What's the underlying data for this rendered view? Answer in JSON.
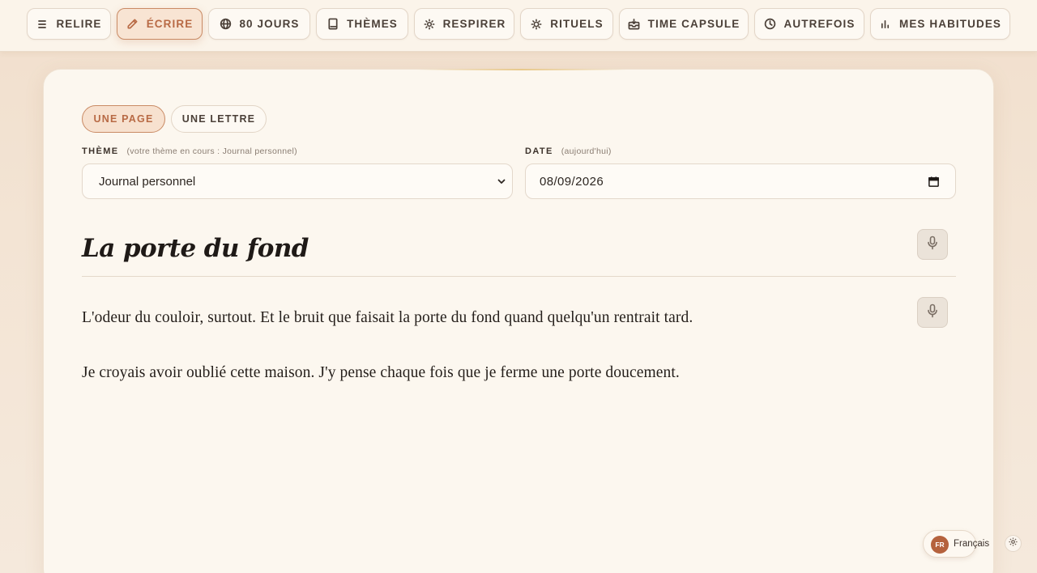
{
  "nav": {
    "items": [
      {
        "label": "RELIRE",
        "icon": "list-icon"
      },
      {
        "label": "ÉCRIRE",
        "icon": "pencil-icon",
        "active": true
      },
      {
        "label": "80 JOURS",
        "icon": "globe-icon"
      },
      {
        "label": "THÈMES",
        "icon": "book-icon"
      },
      {
        "label": "RESPIRER",
        "icon": "sun-icon"
      },
      {
        "label": "RITUELS",
        "icon": "sun-small-icon"
      },
      {
        "label": "TIME CAPSULE",
        "icon": "inbox-icon"
      },
      {
        "label": "AUTREFOIS",
        "icon": "clock-icon"
      },
      {
        "label": "MES HABITUDES",
        "icon": "bar-chart-icon"
      }
    ]
  },
  "mode": {
    "page_label": "UNE PAGE",
    "letter_label": "UNE LETTRE",
    "selected": "UNE PAGE"
  },
  "theme": {
    "label": "THÈME",
    "hint": "(votre thème en cours : Journal personnel)",
    "value": "Journal personnel"
  },
  "date": {
    "label": "DATE",
    "hint": "(aujourd'hui)",
    "value": "08/09/2026"
  },
  "entry": {
    "title": "La porte du fond",
    "paragraphs": [
      "L'odeur du couloir, surtout. Et le bruit que faisait la porte du fond quand quelqu'un rentrait tard.",
      "Je croyais avoir oublié cette maison. J'y pense chaque fois que je ferme une porte doucement."
    ]
  },
  "language": {
    "code": "FR",
    "name": "Français"
  },
  "colors": {
    "accent": "#b86a45",
    "active_bg": "#f8e4d3",
    "card_bg": "#fcf7ef",
    "page_bg": "#f1dfcd"
  }
}
